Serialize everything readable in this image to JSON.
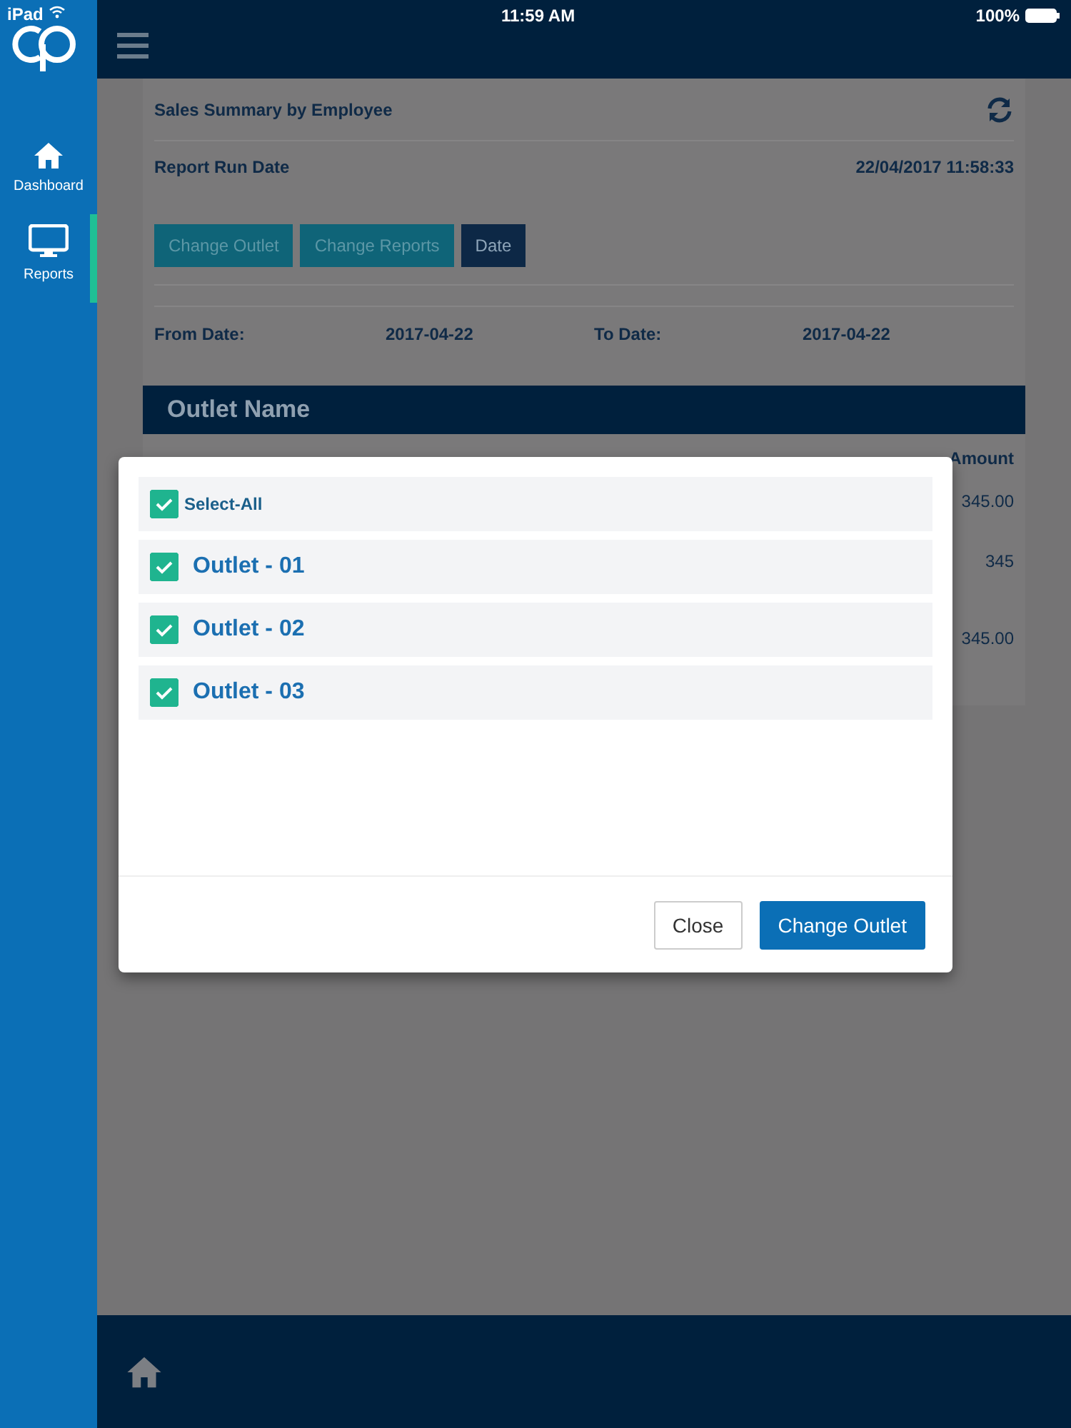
{
  "status_bar": {
    "device": "iPad",
    "time": "11:59 AM",
    "battery": "100%"
  },
  "sidebar": {
    "items": [
      {
        "label": "Dashboard",
        "kind": "home",
        "selected": false
      },
      {
        "label": "Reports",
        "kind": "monitor",
        "selected": true
      }
    ]
  },
  "report": {
    "title": "Sales Summary by Employee",
    "run_date_label": "Report Run Date",
    "run_date": "22/04/2017 11:58:33",
    "buttons": [
      {
        "label": "Change Outlet",
        "selected": false
      },
      {
        "label": "Change Reports",
        "selected": false
      },
      {
        "label": "Date",
        "selected": true
      }
    ],
    "from_label": "From Date:",
    "from_value": "2017-04-22",
    "to_label": "To Date:",
    "to_value": "2017-04-22",
    "section_header": "Outlet Name",
    "amount_header": "Amount",
    "amounts": [
      "345.00",
      "345",
      "345.00"
    ]
  },
  "dialog": {
    "items": [
      {
        "label": "Select-All",
        "kind": "all",
        "checked": true
      },
      {
        "label": "Outlet - 01",
        "kind": "outlet",
        "checked": true
      },
      {
        "label": "Outlet - 02",
        "kind": "outlet",
        "checked": true
      },
      {
        "label": "Outlet - 03",
        "kind": "outlet",
        "checked": true
      }
    ],
    "buttons": [
      {
        "label": "Close",
        "kind": "secondary"
      },
      {
        "label": "Change Outlet",
        "kind": "primary"
      }
    ]
  }
}
